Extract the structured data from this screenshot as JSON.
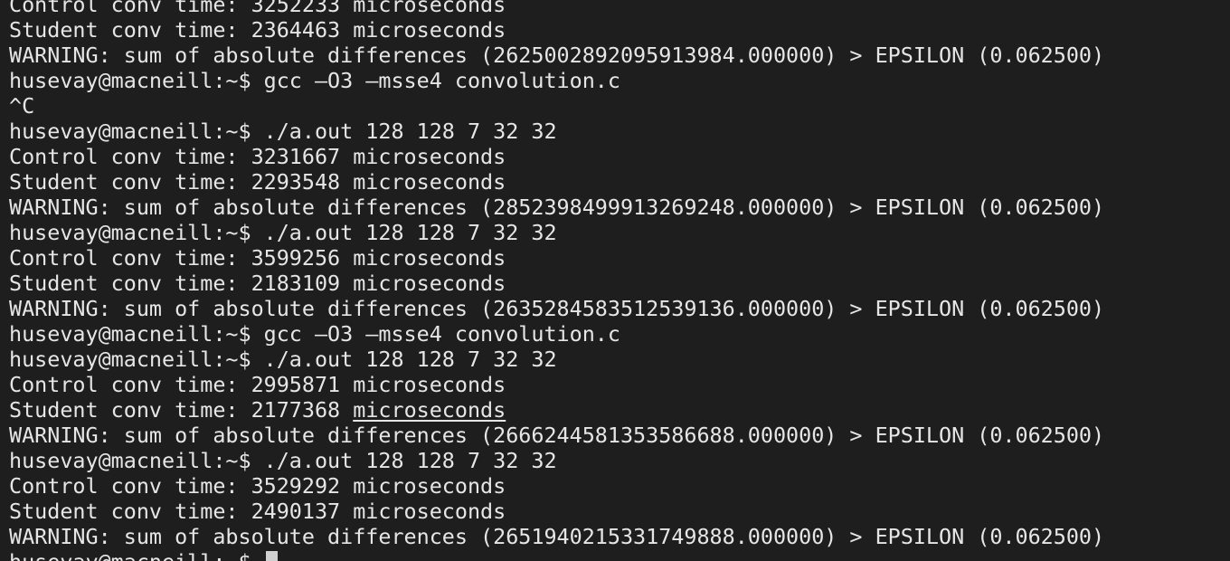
{
  "terminal": {
    "lines": [
      "Control conv time: 3252233 microseconds",
      "Student conv time: 2364463 microseconds",
      "WARNING: sum of absolute differences (2625002892095913984.000000) > EPSILON (0.062500)",
      "husevay@macneill:~$ gcc –O3 –msse4 convolution.c",
      "^C",
      "husevay@macneill:~$ ./a.out 128 128 7 32 32",
      "Control conv time: 3231667 microseconds",
      "Student conv time: 2293548 microseconds",
      "WARNING: sum of absolute differences (2852398499913269248.000000) > EPSILON (0.062500)",
      "husevay@macneill:~$ ./a.out 128 128 7 32 32",
      "Control conv time: 3599256 microseconds",
      "Student conv time: 2183109 microseconds",
      "WARNING: sum of absolute differences (2635284583512539136.000000) > EPSILON (0.062500)",
      "husevay@macneill:~$ gcc –O3 –msse4 convolution.c",
      "husevay@macneill:~$ ./a.out 128 128 7 32 32",
      "Control conv time: 2995871 microseconds",
      "Student conv time: 2177368 ",
      "WARNING: sum of absolute differences (2666244581353586688.000000) > EPSILON (0.062500)",
      "husevay@macneill:~$ ./a.out 128 128 7 32 32",
      "Control conv time: 3529292 microseconds",
      "Student conv time: 2490137 microseconds",
      "WARNING: sum of absolute differences (2651940215331749888.000000) > EPSILON (0.062500)",
      "husevay@macneill:~$ "
    ],
    "underlined_word": "microseconds"
  }
}
